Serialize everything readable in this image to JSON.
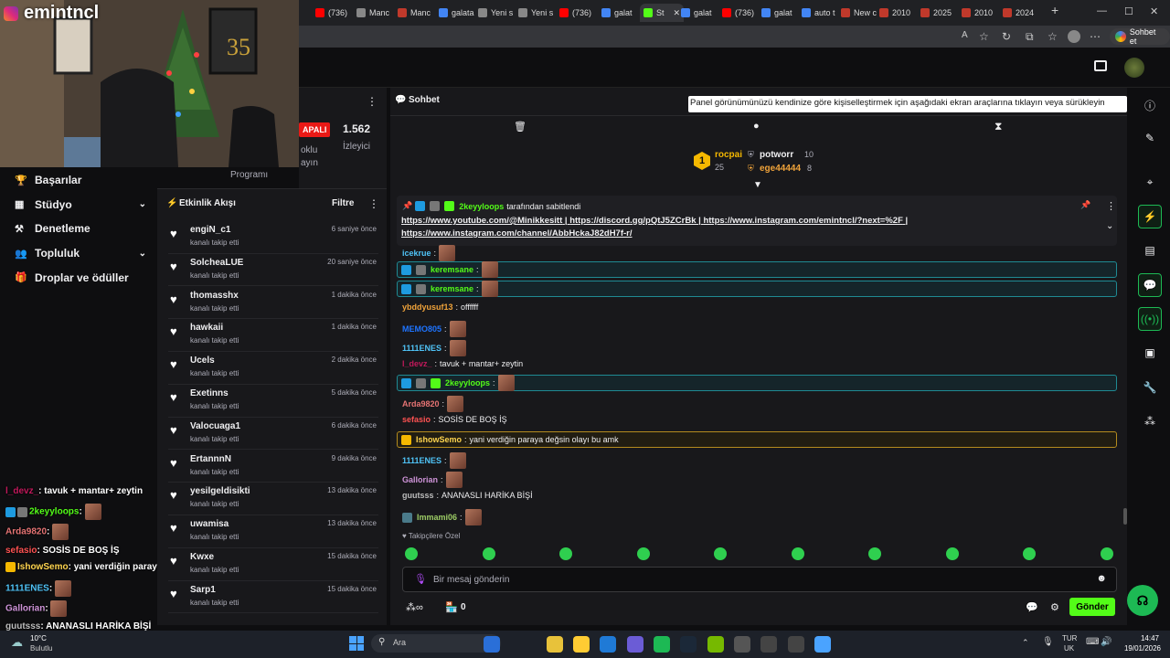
{
  "streamer": {
    "channel_name": "emintncl"
  },
  "browser": {
    "tabs": [
      {
        "label": "(736)",
        "color": "#ff0000"
      },
      {
        "label": "Manc",
        "color": "#888888"
      },
      {
        "label": "Manc",
        "color": "#c0392b"
      },
      {
        "label": "galata",
        "color": "#4285f4"
      },
      {
        "label": "Yeni s",
        "color": "#888888"
      },
      {
        "label": "Yeni s",
        "color": "#888888"
      },
      {
        "label": "(736)",
        "color": "#ff0000"
      },
      {
        "label": "galat",
        "color": "#4285f4"
      },
      {
        "label": "St",
        "color": "#53fc18"
      },
      {
        "label": "galat",
        "color": "#4285f4"
      },
      {
        "label": "(736)",
        "color": "#ff0000"
      },
      {
        "label": "galat",
        "color": "#4285f4"
      },
      {
        "label": "auto t",
        "color": "#4285f4"
      },
      {
        "label": "New c",
        "color": "#c0392b"
      },
      {
        "label": "2010",
        "color": "#c0392b"
      },
      {
        "label": "2025",
        "color": "#c0392b"
      },
      {
        "label": "2010",
        "color": "#c0392b"
      },
      {
        "label": "2024",
        "color": "#c0392b"
      }
    ],
    "chat_button": "Sohbet et"
  },
  "sidebar": {
    "items": [
      {
        "label": "Başarılar",
        "icon": "trophy-icon",
        "expand": false
      },
      {
        "label": "Stüdyo",
        "icon": "studio-icon",
        "expand": true
      },
      {
        "label": "Denetleme",
        "icon": "moderation-icon",
        "expand": false
      },
      {
        "label": "Topluluk",
        "icon": "community-icon",
        "expand": true
      },
      {
        "label": "Droplar ve ödüller",
        "icon": "gift-icon",
        "expand": false
      }
    ]
  },
  "stats": {
    "status_badge": "APALI",
    "viewers": "1.562",
    "viewers_label": "İzleyici",
    "partial_left_1": "oklu",
    "partial_left_2": "ayın",
    "program_label": "Programı"
  },
  "activity": {
    "title": "Etkinlik Akışı",
    "filter_label": "Filtre",
    "items": [
      {
        "user": "engiN_c1",
        "desc": "kanalı takip etti",
        "time": "6 saniye önce"
      },
      {
        "user": "SolcheaLUE",
        "desc": "kanalı takip etti",
        "time": "20 saniye önce"
      },
      {
        "user": "thomasshx",
        "desc": "kanalı takip etti",
        "time": "1 dakika önce"
      },
      {
        "user": "hawkaii",
        "desc": "kanalı takip etti",
        "time": "1 dakika önce"
      },
      {
        "user": "Ucels",
        "desc": "kanalı takip etti",
        "time": "2 dakika önce"
      },
      {
        "user": "Exetinns",
        "desc": "kanalı takip etti",
        "time": "5 dakika önce"
      },
      {
        "user": "Valocuaga1",
        "desc": "kanalı takip etti",
        "time": "6 dakika önce"
      },
      {
        "user": "ErtannnN",
        "desc": "kanalı takip etti",
        "time": "9 dakika önce"
      },
      {
        "user": "yesilgeldisikti",
        "desc": "kanalı takip etti",
        "time": "13 dakika önce"
      },
      {
        "user": "uwamisa",
        "desc": "kanalı takip etti",
        "time": "13 dakika önce"
      },
      {
        "user": "Kwxe",
        "desc": "kanalı takip etti",
        "time": "15 dakika önce"
      },
      {
        "user": "Sarp1",
        "desc": "kanalı takip etti",
        "time": "15 dakika önce"
      }
    ]
  },
  "chat": {
    "header_title": "Sohbet",
    "tooltip": "Panel görünümünüzü kendinize göre kişiselleştirmek için aşağıdaki ekran araçlarına tıklayın veya sürükleyin",
    "leaderboard": {
      "first": {
        "rank": "1",
        "user": "rocpai",
        "count": "25"
      },
      "second": {
        "user": "potworr",
        "count": "10"
      },
      "third": {
        "user": "ege44444",
        "count": "8"
      }
    },
    "pinned": {
      "by_user": "2keyyloops",
      "by_text": "tarafından sabitlendi",
      "link1": "https://www.youtube.com/@Minikkesitt",
      "link2": "https://discord.gg/pQtJ5ZCrBk",
      "link3": "https://www.instagram.com/emintncl/?next=%2F",
      "link4": "https://www.instagram.com/channel/AbbHckaJ82dH7f-r/",
      "sep": "|"
    },
    "messages": [
      {
        "name": "icekrue",
        "color": "#4fc3f7",
        "text": "",
        "emote": true,
        "style": "plain"
      },
      {
        "name": "keremsane",
        "color": "#53fc18",
        "text": "",
        "emote": true,
        "style": "hl"
      },
      {
        "name": "keremsane",
        "color": "#53fc18",
        "text": "",
        "emote": true,
        "style": "hl"
      },
      {
        "name": "ybddyusuf13",
        "color": "#f0a33a",
        "text": "offffff",
        "emote": false,
        "style": "plain"
      },
      {
        "name": "MEMO805",
        "color": "#1e74ff",
        "text": "",
        "emote": true,
        "style": "plain"
      },
      {
        "name": "1111ENES",
        "color": "#4fc3f7",
        "text": "",
        "emote": true,
        "style": "plain"
      },
      {
        "name": "l_devz_",
        "color": "#c2185b",
        "text": "tavuk + mantar+ zeytin",
        "emote": false,
        "style": "plain"
      },
      {
        "name": "2keyyloops",
        "color": "#53fc18",
        "text": "",
        "emote": true,
        "style": "hl"
      },
      {
        "name": "Arda9820",
        "color": "#e57373",
        "text": "",
        "emote": true,
        "style": "plain"
      },
      {
        "name": "sefasio",
        "color": "#ff5252",
        "text": "SOSİS DE BOŞ İŞ",
        "emote": false,
        "style": "plain"
      },
      {
        "name": "IshowSemo",
        "color": "#ffd54f",
        "text": "yani verdiğin paraya değsin olayı bu amk",
        "emote": false,
        "style": "gold"
      },
      {
        "name": "1111ENES",
        "color": "#4fc3f7",
        "text": "",
        "emote": true,
        "style": "plain"
      },
      {
        "name": "Gallorian",
        "color": "#ce93d8",
        "text": "",
        "emote": true,
        "style": "plain"
      },
      {
        "name": "guutsss",
        "color": "#bdbdbd",
        "text": "ANANASLI HARİKA BİŞİ",
        "emote": false,
        "style": "plain"
      },
      {
        "name": "Immami06",
        "color": "#9ccc65",
        "text": "",
        "emote": true,
        "style": "plain"
      }
    ],
    "followers_only": "Takipçilere Özel",
    "input_placeholder": "Bir mesaj gönderin",
    "points": "0",
    "send_label": "Gönder"
  },
  "overlay_chat": [
    {
      "name": "l_devz_",
      "color": "#c2185b",
      "text": "tavuk + mantar+ zeytin",
      "emote": false
    },
    {
      "name": "2keyyloops",
      "color": "#53fc18",
      "text": "",
      "emote": true
    },
    {
      "name": "Arda9820",
      "color": "#e57373",
      "text": "",
      "emote": true
    },
    {
      "name": "sefasio",
      "color": "#ff5252",
      "text": "SOSİS DE BOŞ İŞ",
      "emote": false
    },
    {
      "name": "IshowSemo",
      "color": "#ffd54f",
      "text": "yani verdiğin paraya değsin olayı bu amk",
      "emote": false
    },
    {
      "name": "1111ENES",
      "color": "#4fc3f7",
      "text": "",
      "emote": true
    },
    {
      "name": "Gallorian",
      "color": "#ce93d8",
      "text": "",
      "emote": true
    },
    {
      "name": "guutsss",
      "color": "#bdbdbd",
      "text": "ANANASLI HARİKA BİŞİ",
      "emote": false
    }
  ],
  "taskbar": {
    "weather_temp": "10°C",
    "weather_desc": "Bulutlu",
    "search_placeholder": "Ara",
    "lang_1": "TUR",
    "lang_2": "UK",
    "time": "14:47",
    "date": "19/01/2026"
  }
}
